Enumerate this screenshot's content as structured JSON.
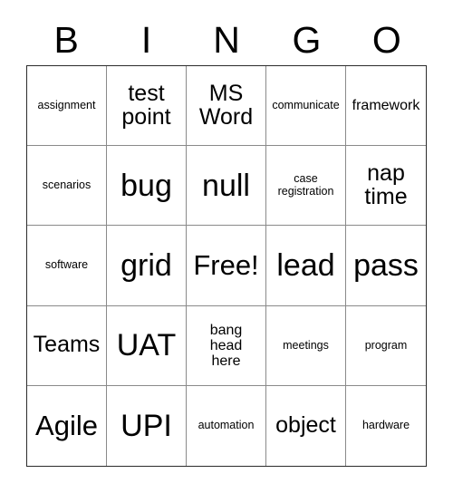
{
  "card": {
    "title": "BINGO",
    "header_letters": [
      "B",
      "I",
      "N",
      "G",
      "O"
    ],
    "free_space_label": "Free!",
    "free_space_position": {
      "row": 3,
      "column": 3
    },
    "grid_size": "5x5",
    "colors": {
      "background": "#ffffff",
      "text": "#000000",
      "inner_border": "#8a8a8a",
      "outer_border": "#2b2b2b"
    },
    "rows": [
      [
        {
          "text": "assignment",
          "size": "xs"
        },
        {
          "text": "test\npoint",
          "size": "md"
        },
        {
          "text": "MS\nWord",
          "size": "md"
        },
        {
          "text": "communicate",
          "size": "xs"
        },
        {
          "text": "framework",
          "size": "sm"
        }
      ],
      [
        {
          "text": "scenarios",
          "size": "xs"
        },
        {
          "text": "bug",
          "size": "xl"
        },
        {
          "text": "null",
          "size": "xl"
        },
        {
          "text": "case\nregistration",
          "size": "xs"
        },
        {
          "text": "nap\ntime",
          "size": "md"
        }
      ],
      [
        {
          "text": "software",
          "size": "xs"
        },
        {
          "text": "grid",
          "size": "xl"
        },
        {
          "text": "Free!",
          "size": "lg"
        },
        {
          "text": "lead",
          "size": "xl"
        },
        {
          "text": "pass",
          "size": "xl"
        }
      ],
      [
        {
          "text": "Teams",
          "size": "md"
        },
        {
          "text": "UAT",
          "size": "xl"
        },
        {
          "text": "bang\nhead\nhere",
          "size": "sm"
        },
        {
          "text": "meetings",
          "size": "xs"
        },
        {
          "text": "program",
          "size": "xs"
        }
      ],
      [
        {
          "text": "Agile",
          "size": "lg"
        },
        {
          "text": "UPI",
          "size": "xl"
        },
        {
          "text": "automation",
          "size": "xs"
        },
        {
          "text": "object",
          "size": "md"
        },
        {
          "text": "hardware",
          "size": "xs"
        }
      ]
    ]
  }
}
